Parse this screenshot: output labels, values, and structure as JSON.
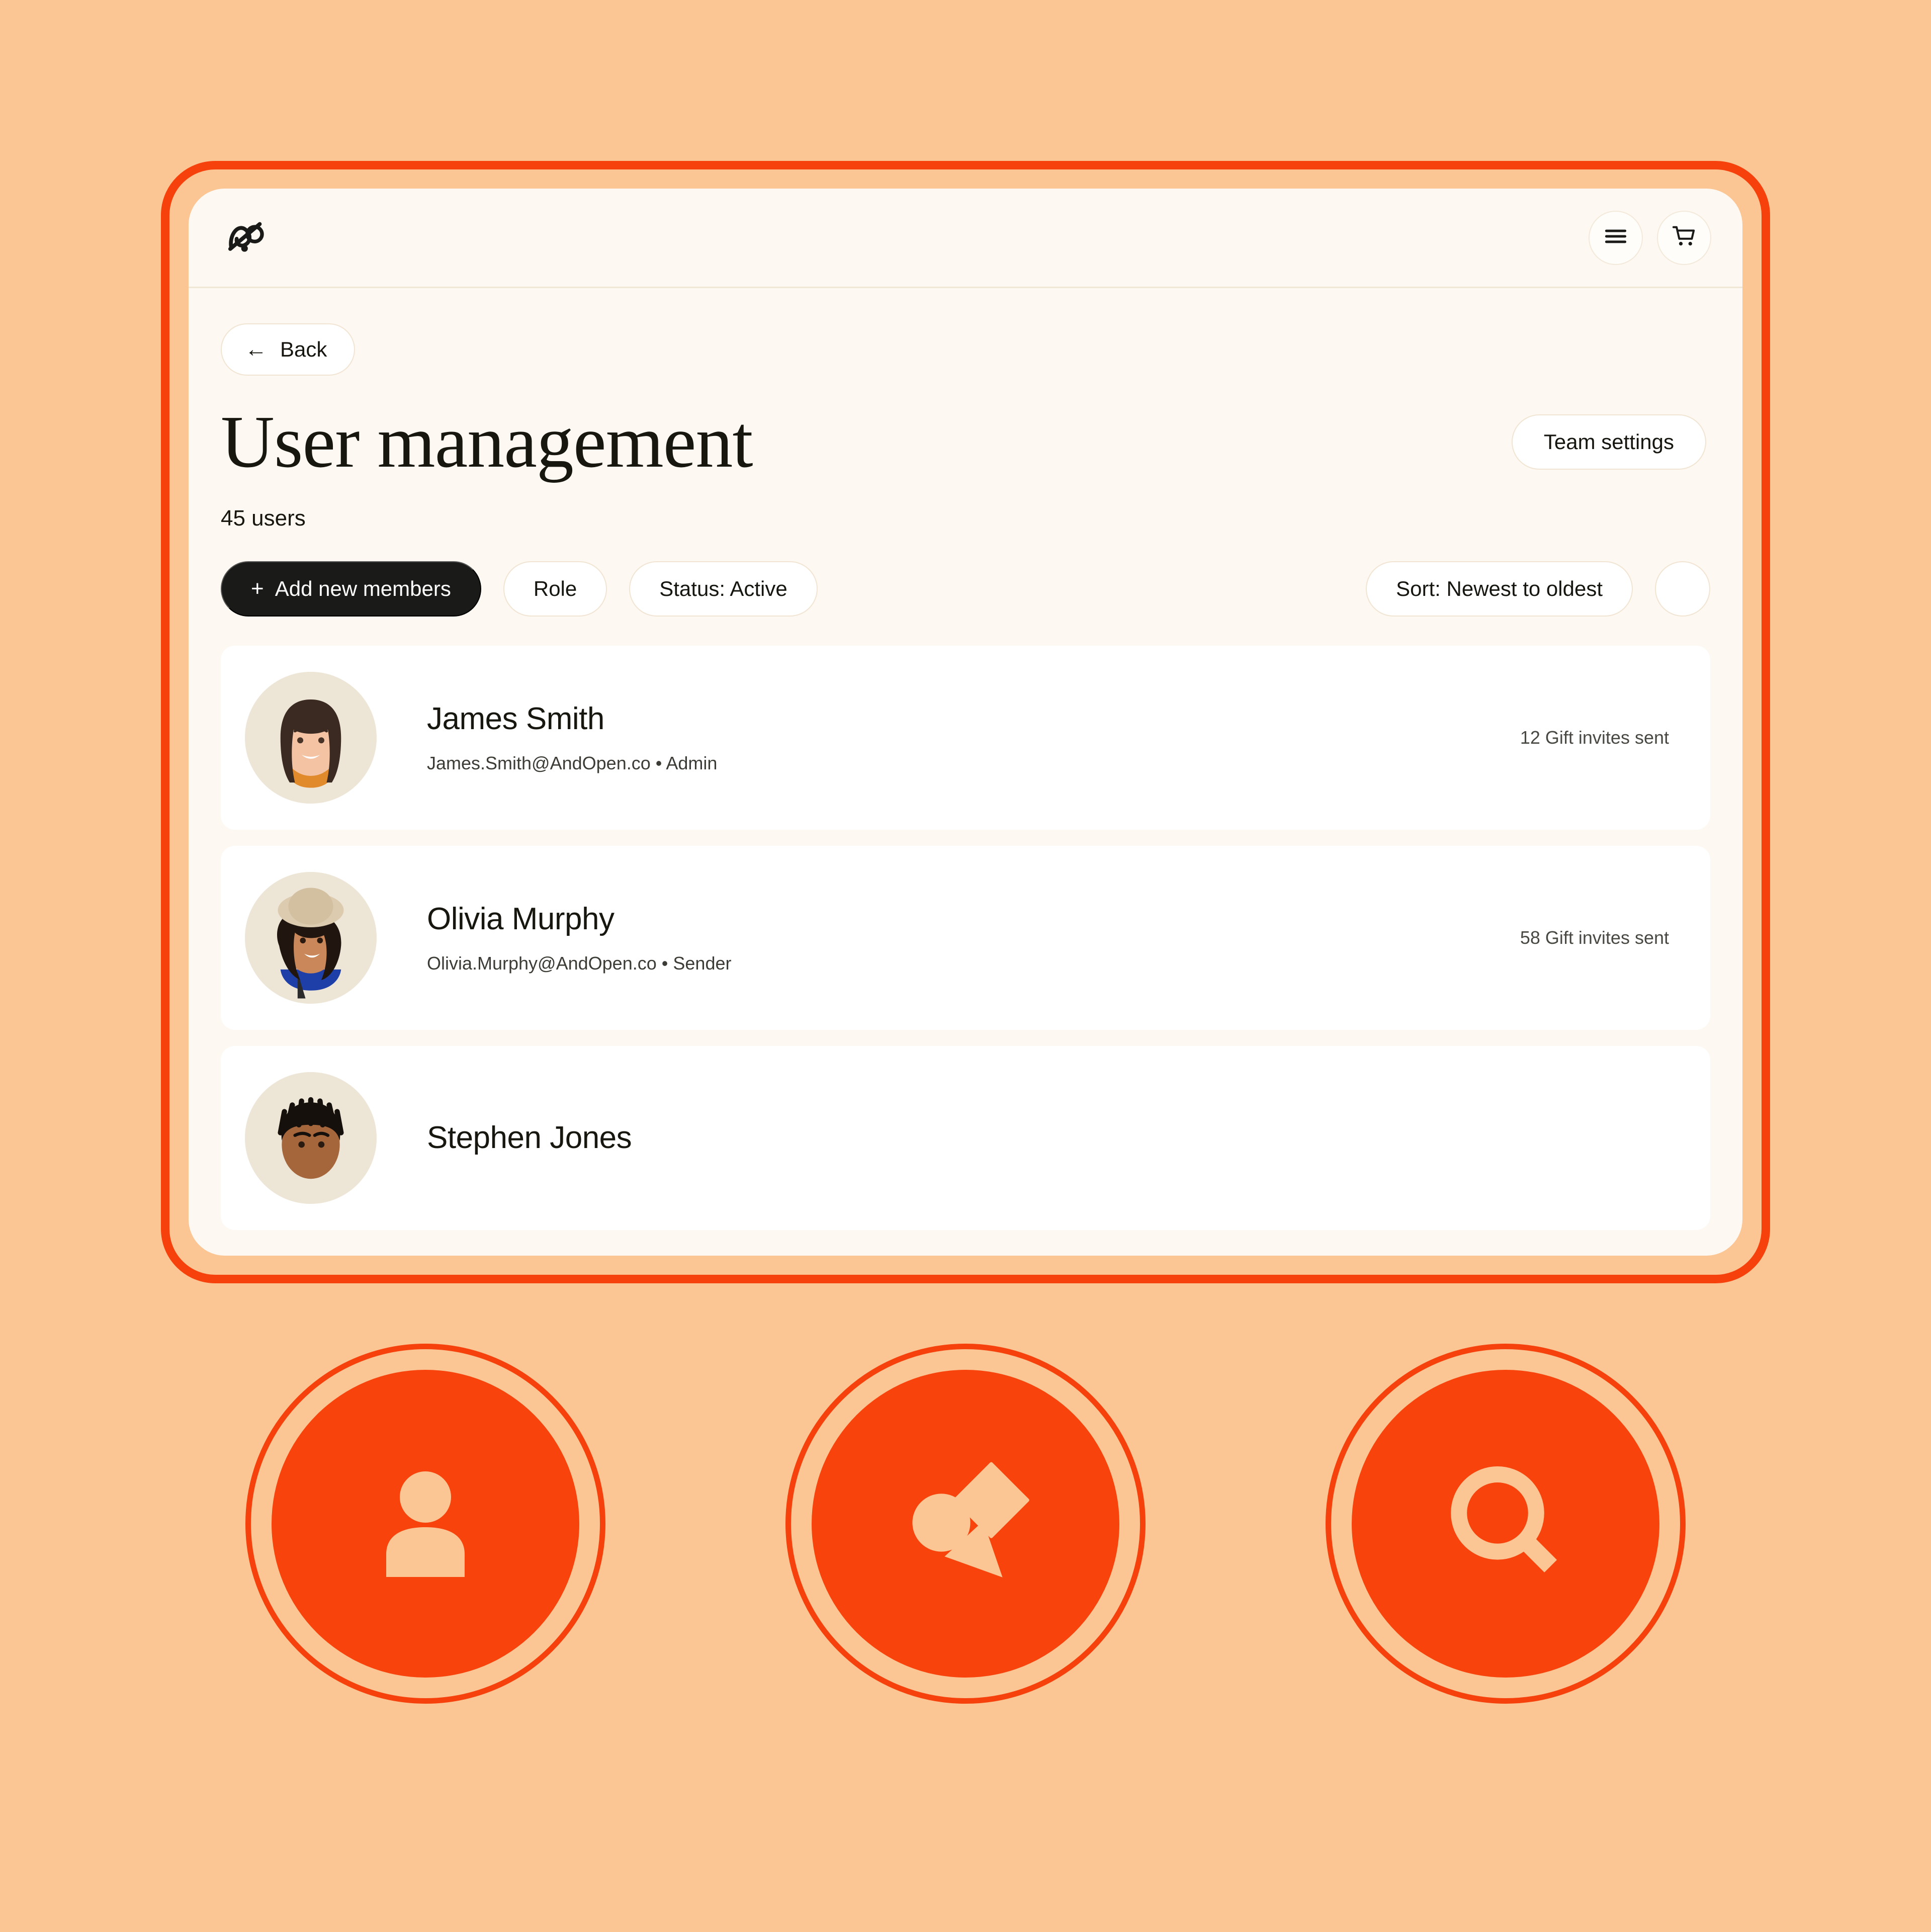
{
  "theme": {
    "page_background": "#FBC694",
    "frame_border": "#F6410C",
    "screen_background": "#FDF8F1",
    "card_background": "#FFFFFF",
    "accent": "#F9430C",
    "text_primary": "#17160F",
    "primary_button_background": "#1A1A18"
  },
  "app": {
    "logo_icon": "andopen-logo-icon",
    "topbar_actions": [
      {
        "icon": "hamburger-menu-icon",
        "name": "menu-button"
      },
      {
        "icon": "shopping-cart-icon",
        "name": "cart-button"
      }
    ]
  },
  "page": {
    "back_label": "Back",
    "back_icon": "arrow-left-icon",
    "title": "User management",
    "team_settings_label": "Team settings",
    "user_count": "45 users"
  },
  "filters": {
    "add_members_label": "Add new members",
    "add_members_icon": "plus-icon",
    "role_label": "Role",
    "status_label": "Status: Active",
    "sort_label": "Sort: Newest to oldest",
    "extra_button_icon": "blank-circle-icon"
  },
  "users": [
    {
      "name": "James Smith",
      "email": "James.Smith@AndOpen.co",
      "separator": "•",
      "role": "Admin",
      "stat": "12 Gift invites sent",
      "avatar": "avatar-james-smith"
    },
    {
      "name": "Olivia Murphy",
      "email": "Olivia.Murphy@AndOpen.co",
      "separator": "•",
      "role": "Sender",
      "stat": "58 Gift invites sent",
      "avatar": "avatar-olivia-murphy"
    },
    {
      "name": "Stephen Jones",
      "email": "",
      "separator": "",
      "role": "",
      "stat": "",
      "avatar": "avatar-stephen-jones"
    }
  ],
  "badges": [
    {
      "icon": "person-icon",
      "label": "person"
    },
    {
      "icon": "shapes-icon",
      "label": "shapes"
    },
    {
      "icon": "search-icon",
      "label": "search"
    }
  ]
}
